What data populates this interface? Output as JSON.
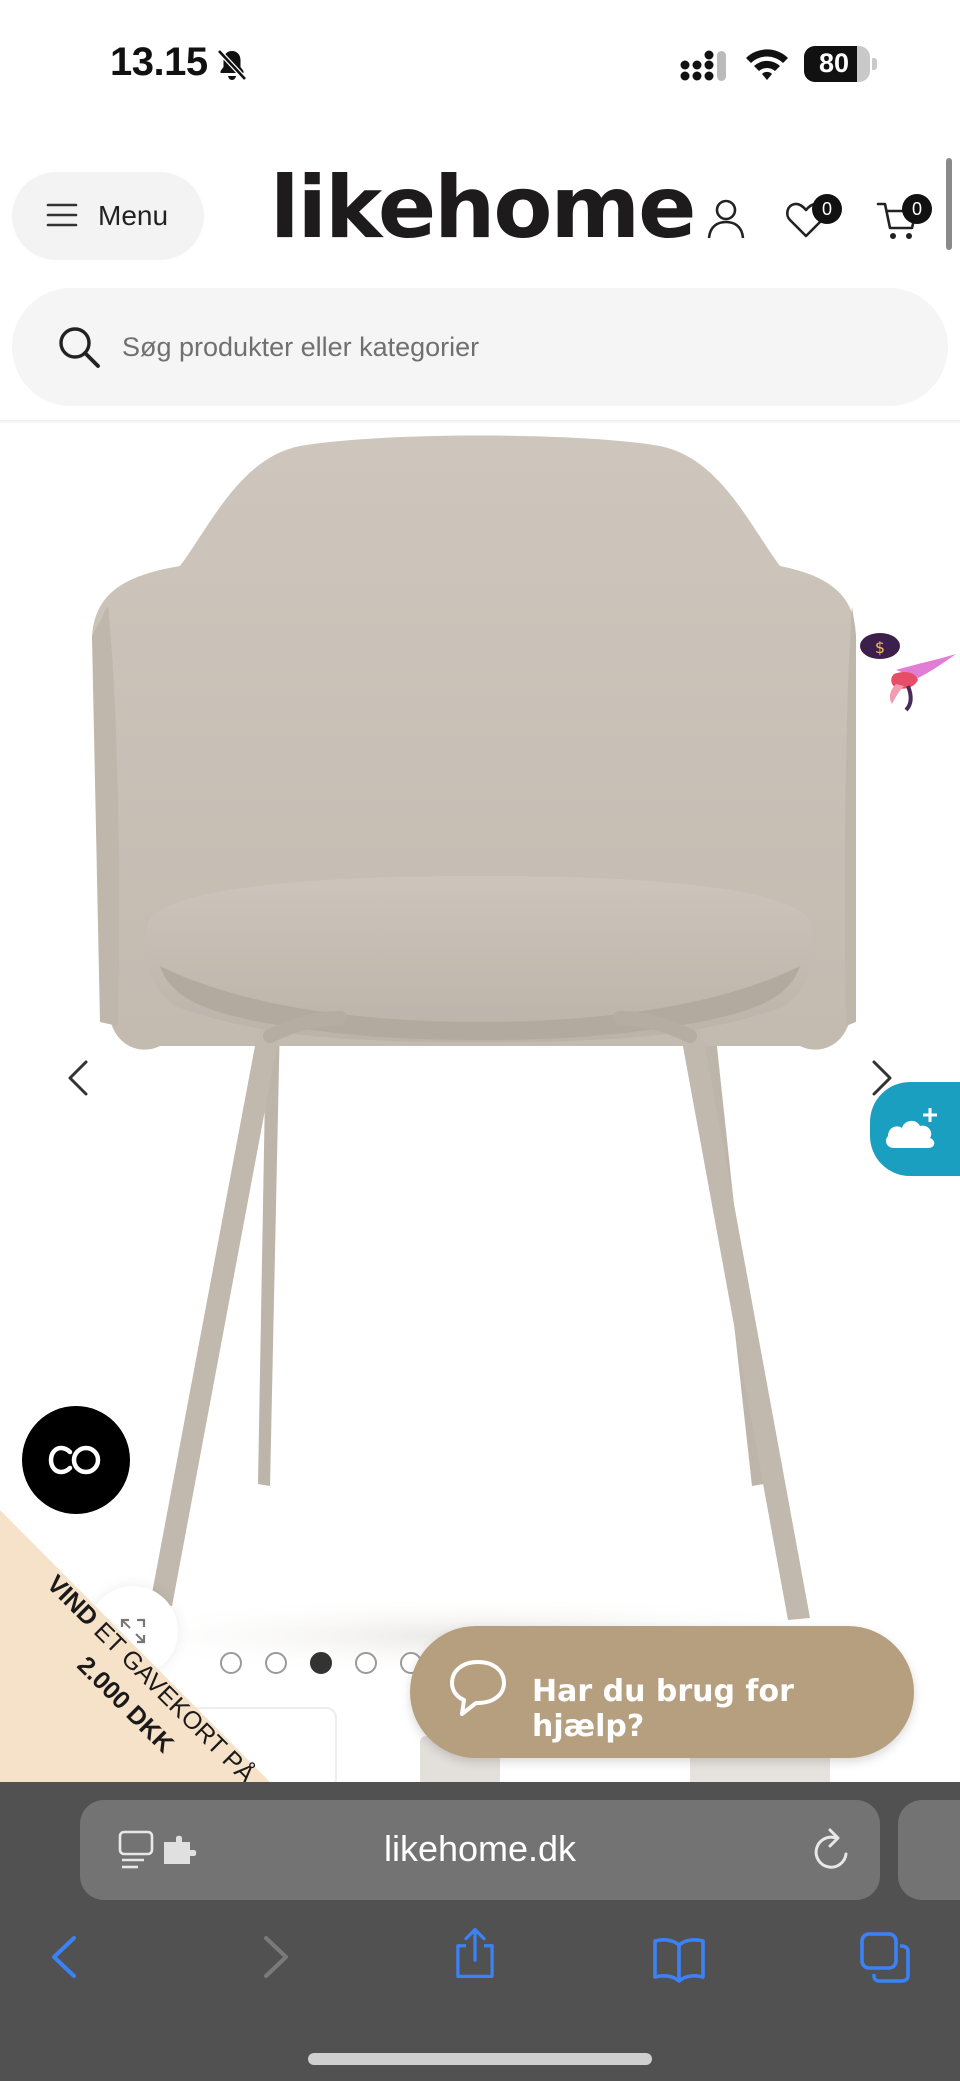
{
  "status_bar": {
    "time": "13.15",
    "battery": "80",
    "battery_level": 0.8
  },
  "header": {
    "menu_label": "Menu",
    "logo": "likehome",
    "wishlist_count": "0",
    "cart_count": "0"
  },
  "search": {
    "placeholder": "Søg produkter eller kategorier",
    "value": ""
  },
  "product": {
    "image_alt": "beige upholstered dining chair with metal legs",
    "gallery_dots": 5,
    "active_dot": 3
  },
  "promo": {
    "line1_bold": "VIND",
    "line1_rest": " ET GAVEKORT PÅ",
    "line2": "2.000 DKK"
  },
  "help": {
    "label": "Har du brug for hjælp?"
  },
  "browser": {
    "url": "likehome.dk"
  },
  "colors": {
    "help_button": "#b69f7f",
    "cloud_button": "#1a9fc0",
    "promo_ribbon": "#f6e2c9",
    "safari_bar": "#515151",
    "chair_fabric": "#cbc3b9"
  }
}
